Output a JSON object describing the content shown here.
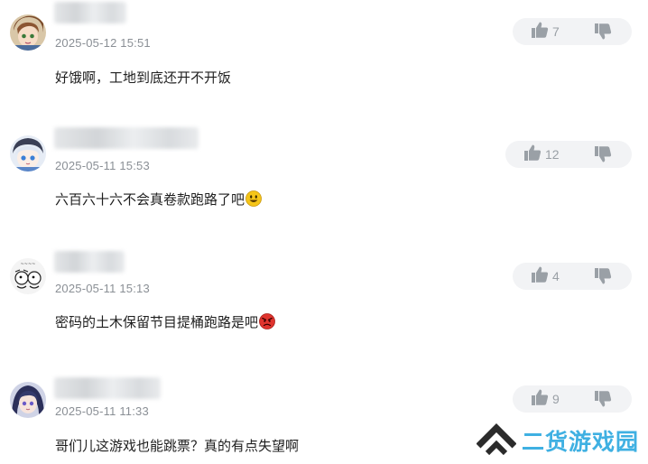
{
  "comments": [
    {
      "timestamp": "2025-05-12 15:51",
      "text": "好饿啊，工地到底还开不开饭",
      "likes": "7",
      "emoji": ""
    },
    {
      "timestamp": "2025-05-11 15:53",
      "text": "六百六十六不会真卷款跑路了吧",
      "likes": "12",
      "emoji": "grinning-face"
    },
    {
      "timestamp": "2025-05-11 15:13",
      "text": "密码的土木保留节目提桶跑路是吧",
      "likes": "4",
      "emoji": "angry-face"
    },
    {
      "timestamp": "2025-05-11 11:33",
      "text": "哥们儿这游戏也能跳票？真的有点失望啊",
      "likes": "9",
      "emoji": ""
    }
  ],
  "icons": {
    "like": "thumbs-up-icon",
    "dislike": "thumbs-down-icon"
  },
  "watermark": {
    "text": "二货游戏园"
  },
  "colors": {
    "timestamp": "#8a8f95",
    "vote_bg": "#f2f3f5",
    "vote_icon": "#9aa0a6",
    "watermark_blue": "#3fb0e2",
    "watermark_dark": "#2b2b2b"
  }
}
